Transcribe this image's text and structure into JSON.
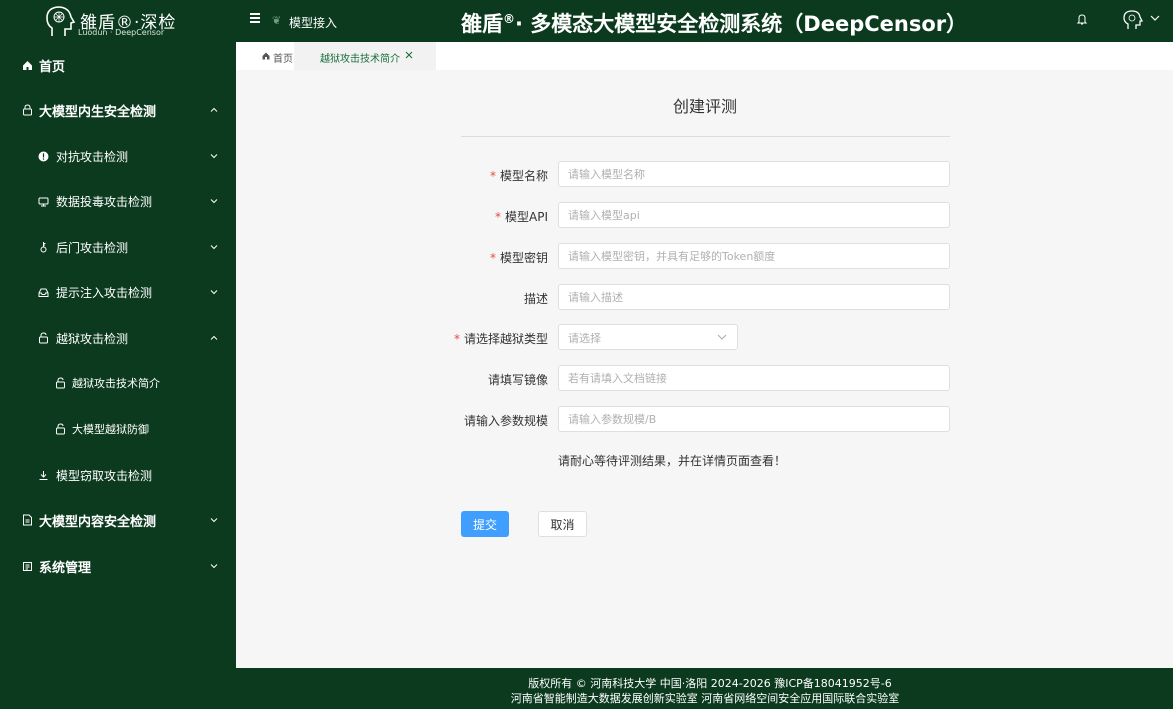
{
  "header": {
    "logo_title": "雒盾®·深检",
    "logo_subtitle": "Luodun · DeepCensor",
    "breadcrumb": "模型接入",
    "system_title_a": "雒盾",
    "system_title_reg": "®",
    "system_title_b": "· 多模态大模型安全检测系统（DeepCensor）"
  },
  "sidebar": {
    "items": [
      {
        "label": "首页",
        "icon": "home-icon"
      },
      {
        "label": "大模型内生安全检测",
        "icon": "lock-icon"
      },
      {
        "label": "对抗攻击检测",
        "icon": "alert-icon"
      },
      {
        "label": "数据投毒攻击检测",
        "icon": "poison-icon"
      },
      {
        "label": "后门攻击检测",
        "icon": "key-icon"
      },
      {
        "label": "提示注入攻击检测",
        "icon": "inbox-icon"
      },
      {
        "label": "越狱攻击检测",
        "icon": "unlock-icon"
      },
      {
        "label": "越狱攻击技术简介",
        "icon": "unlock-icon"
      },
      {
        "label": "大模型越狱防御",
        "icon": "unlock-icon"
      },
      {
        "label": "模型窃取攻击检测",
        "icon": "download-icon"
      },
      {
        "label": "大模型内容安全检测",
        "icon": "document-icon"
      },
      {
        "label": "系统管理",
        "icon": "settings-icon"
      }
    ]
  },
  "tabs": {
    "home": "首页",
    "active": "越狱攻击技术简介"
  },
  "form": {
    "title": "创建评测",
    "model_name_label": "模型名称",
    "model_name_placeholder": "请输入模型名称",
    "model_api_label": "模型API",
    "model_api_placeholder": "请输入模型api",
    "model_key_label": "模型密钥",
    "model_key_placeholder": "请输入模型密钥，并具有足够的Token额度",
    "description_label": "描述",
    "description_placeholder": "请输入描述",
    "jailbreak_type_label": "请选择越狱类型",
    "jailbreak_type_placeholder": "请选择",
    "mirror_label": "请填写镜像",
    "mirror_placeholder": "若有请填入文档链接",
    "param_size_label": "请输入参数规模",
    "param_size_placeholder": "请输入参数规模/B",
    "hint": "请耐心等待评测结果，并在详情页面查看！",
    "submit": "提交",
    "cancel": "取消"
  },
  "footer": {
    "line1": "版权所有 © 河南科技大学  中国·洛阳  2024-2026     豫ICP备18041952号-6",
    "line2": "河南省智能制造大数据发展创新实验室  河南省网络空间安全应用国际联合实验室"
  },
  "colors": {
    "theme_green": "#0c3a1e",
    "primary_button": "#409eff",
    "required_star": "#e74c3c"
  }
}
